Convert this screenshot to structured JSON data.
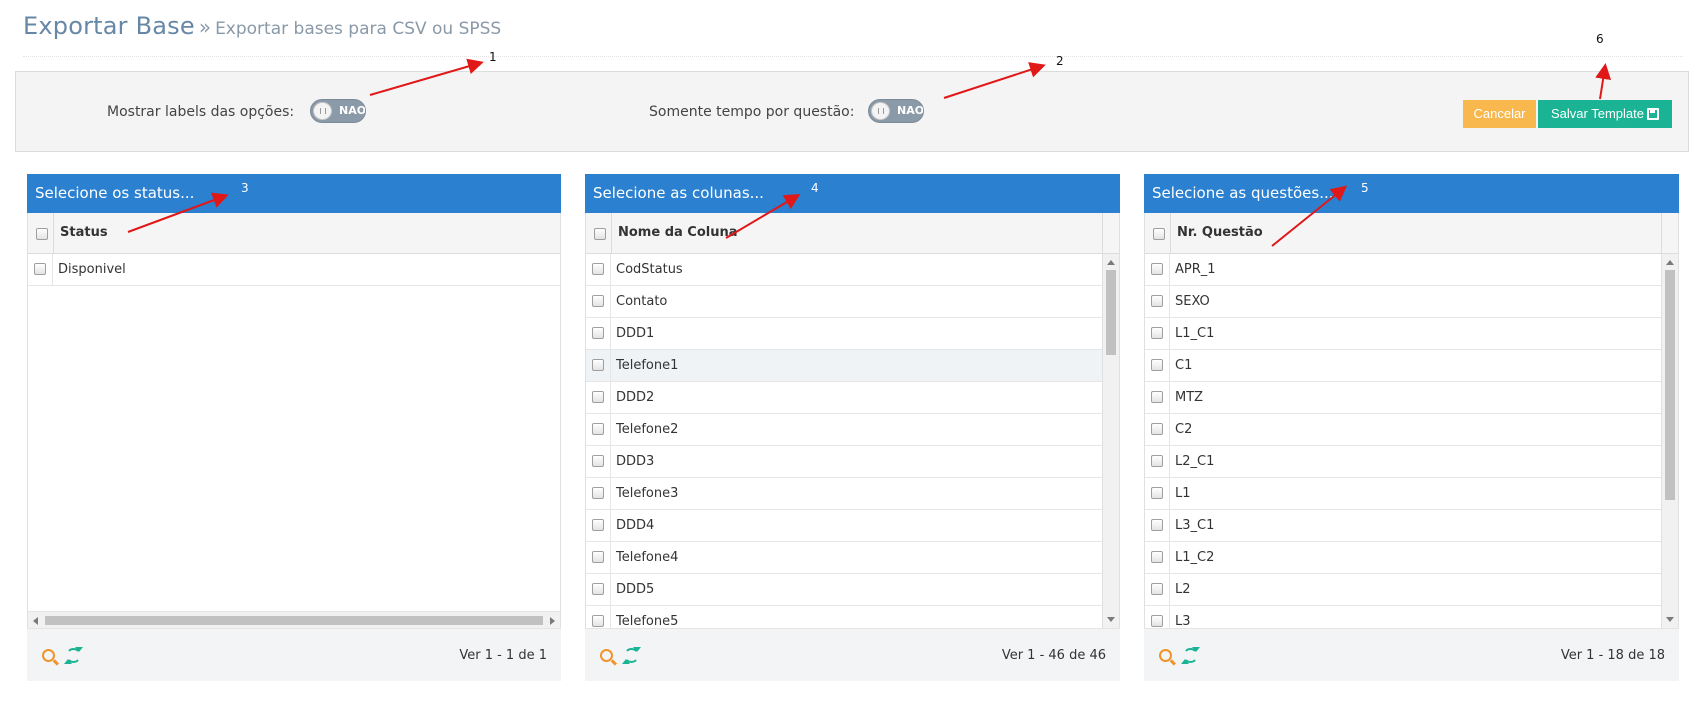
{
  "header": {
    "title": "Exportar Base",
    "separator": "»",
    "subtitle": "Exportar bases para CSV ou SPSS"
  },
  "options": {
    "show_labels": {
      "label": "Mostrar labels das opções:",
      "toggle_text": "NAO",
      "on": false
    },
    "time_only": {
      "label": "Somente tempo por questão:",
      "toggle_text": "NAO",
      "on": false
    },
    "cancel_label": "Cancelar",
    "save_label": "Salvar Template",
    "colors": {
      "cancel": "#f8b84e",
      "save": "#1ab394",
      "panel_header": "#2b80d0"
    }
  },
  "panels": {
    "status": {
      "title": "Selecione os status...",
      "column": "Status",
      "rows": [
        "Disponivel"
      ],
      "pager": "Ver 1 - 1 de 1"
    },
    "columns": {
      "title": "Selecione as colunas...",
      "column": "Nome da Coluna",
      "rows": [
        "CodStatus",
        "Contato",
        "DDD1",
        "Telefone1",
        "DDD2",
        "Telefone2",
        "DDD3",
        "Telefone3",
        "DDD4",
        "Telefone4",
        "DDD5",
        "Telefone5"
      ],
      "highlighted_row": "Telefone1",
      "pager": "Ver 1 - 46 de 46"
    },
    "questions": {
      "title": "Selecione as questões...",
      "column": "Nr. Questão",
      "rows": [
        "APR_1",
        "SEXO",
        "L1_C1",
        "C1",
        "MTZ",
        "C2",
        "L2_C1",
        "L1",
        "L3_C1",
        "L1_C2",
        "L2",
        "L3"
      ],
      "pager": "Ver 1 - 18 de 18"
    }
  },
  "annotations": [
    "1",
    "2",
    "3",
    "4",
    "5",
    "6"
  ],
  "icons": [
    "search-icon",
    "refresh-icon",
    "save-icon",
    "checkbox-icon"
  ]
}
